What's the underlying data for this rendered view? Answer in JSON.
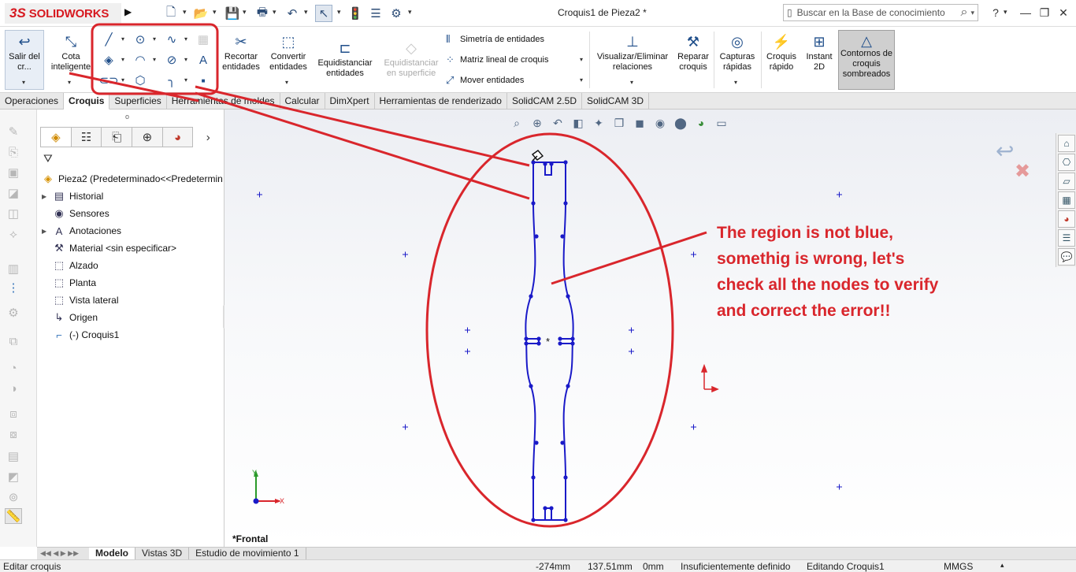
{
  "app": {
    "logo": {
      "mark": "3S",
      "name": "SOLIDWORKS"
    },
    "document_title": "Croquis1 de Pieza2 *",
    "search_placeholder": "Buscar en la Base de conocimiento"
  },
  "ribbon": {
    "salir": "Salir del cr...",
    "cota": "Cota inteligente",
    "recortar": "Recortar entidades",
    "convertir": "Convertir entidades",
    "equidistanciar": "Equidistanciar entidades",
    "equidistanciar_superficie": "Equidistanciar en superficie",
    "simetria": "Simetría de entidades",
    "matriz": "Matriz lineal de croquis",
    "mover": "Mover entidades",
    "visualizar": "Visualizar/Eliminar relaciones",
    "reparar": "Reparar croquis",
    "capturas": "Capturas rápidas",
    "croquis_rapido": "Croquis rápido",
    "instant2d": "Instant 2D",
    "contornos": "Contornos de croquis sombreados"
  },
  "command_tabs": [
    "Operaciones",
    "Croquis",
    "Superficies",
    "Herramientas de moldes",
    "Calcular",
    "DimXpert",
    "Herramientas de renderizado",
    "SolidCAM 2.5D",
    "SolidCAM 3D"
  ],
  "tree": {
    "root": "Pieza2  (Predeterminado<<Predetermin",
    "items": [
      {
        "label": "Historial",
        "icon": "history-icon"
      },
      {
        "label": "Sensores",
        "icon": "sensor-icon"
      },
      {
        "label": "Anotaciones",
        "icon": "annotation-icon"
      },
      {
        "label": "Material <sin especificar>",
        "icon": "material-icon"
      },
      {
        "label": "Alzado",
        "icon": "plane-icon"
      },
      {
        "label": "Planta",
        "icon": "plane-icon"
      },
      {
        "label": "Vista lateral",
        "icon": "plane-icon"
      },
      {
        "label": "Origen",
        "icon": "origin-icon"
      },
      {
        "label": "(-) Croquis1",
        "icon": "sketch-icon"
      }
    ]
  },
  "graphics": {
    "view_label": "*Frontal",
    "annotation": "The region is not blue, somethig is wrong, let's check all the nodes to verify and correct the error!!",
    "annotation_color": "#d9262c",
    "sketch_color": "#1a1ac8",
    "triad_labels": {
      "x": "X",
      "y": "Y"
    }
  },
  "bottom_tabs": [
    "Modelo",
    "Vistas 3D",
    "Estudio de movimiento 1"
  ],
  "status": {
    "left": "Editar croquis",
    "x": "-274mm",
    "y": "137.51mm",
    "z": "0mm",
    "definition": "Insuficientemente definido",
    "mode": "Editando Croquis1",
    "units": "MMGS"
  }
}
